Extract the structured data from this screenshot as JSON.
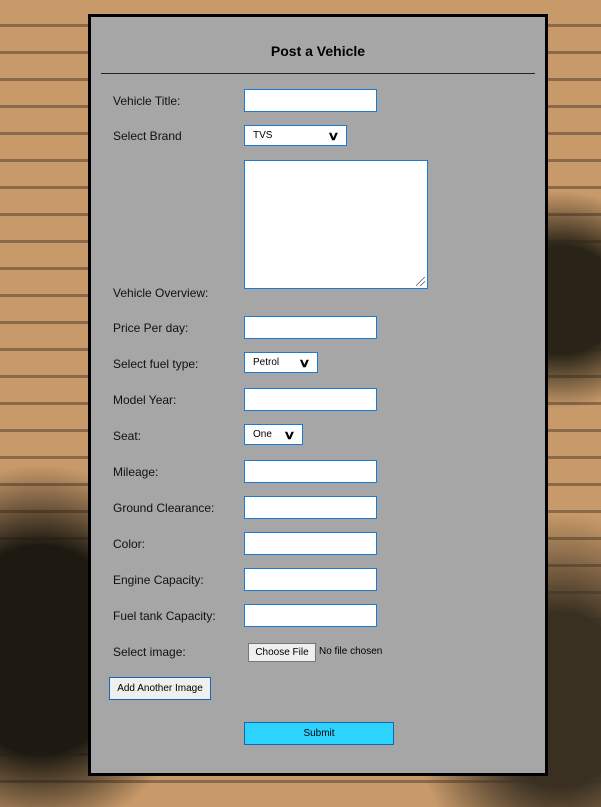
{
  "form": {
    "title": "Post a Vehicle",
    "labels": {
      "vehicle_title": "Vehicle Title:",
      "brand": "Select Brand",
      "overview": "Vehicle Overview:",
      "price": "Price Per day:",
      "fuel": "Select fuel type:",
      "model_year": "Model Year:",
      "seat": "Seat:",
      "mileage": "Mileage:",
      "ground_clearance": "Ground Clearance:",
      "color": "Color:",
      "engine": "Engine Capacity:",
      "fuel_tank": "Fuel tank Capacity:",
      "image": "Select image:"
    },
    "brand_value": "TVS",
    "fuel_value": "Petrol",
    "seat_value": "One",
    "choose_file": "Choose File",
    "no_file": "No file chosen",
    "add_image": "Add Another Image",
    "submit": "Submit",
    "submit_color": "#2cd3ff"
  }
}
